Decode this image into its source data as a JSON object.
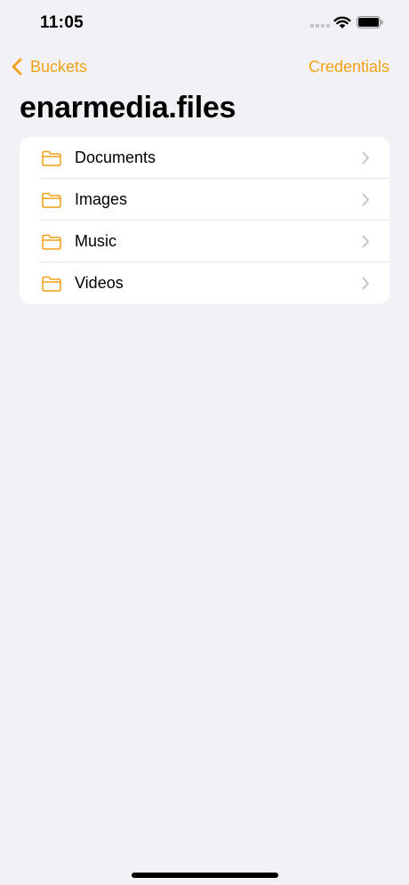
{
  "status_bar": {
    "time": "11:05"
  },
  "nav": {
    "back_label": "Buckets",
    "right_label": "Credentials"
  },
  "page": {
    "title": "enarmedia.files"
  },
  "folders": [
    {
      "label": "Documents",
      "icon": "folder-icon"
    },
    {
      "label": "Images",
      "icon": "folder-icon"
    },
    {
      "label": "Music",
      "icon": "folder-icon"
    },
    {
      "label": "Videos",
      "icon": "folder-icon"
    }
  ],
  "colors": {
    "accent": "#f2a117",
    "background": "#f2f1f6",
    "card": "#ffffff",
    "chevron": "#c4c4c8"
  }
}
